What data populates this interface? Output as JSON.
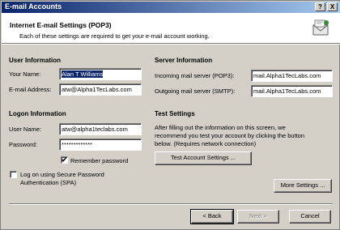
{
  "window": {
    "title": "E-mail Accounts",
    "help_glyph": "?",
    "close_glyph": "X"
  },
  "header": {
    "title": "Internet E-mail Settings (POP3)",
    "subtitle": "Each of these settings are required to get your e-mail account working."
  },
  "user_info": {
    "heading": "User Information",
    "name_label": "Your Name:",
    "name_value": "Alan T Williams",
    "email_label": "E-mail Address:",
    "email_value": "atw@Alpha1TecLabs.com"
  },
  "logon_info": {
    "heading": "Logon Information",
    "username_label": "User Name:",
    "username_value": "atw@alpha1teclabs.com",
    "password_label": "Password:",
    "password_value": "*************",
    "remember_label": "Remember password",
    "remember_checked": true,
    "spa_label_1": "Log on using Secure Password",
    "spa_label_2": "Authentication (SPA)",
    "spa_checked": false
  },
  "server_info": {
    "heading": "Server Information",
    "incoming_label": "Incoming mail server (POP3):",
    "incoming_value": "mail.Alpha1TecLabs.com",
    "outgoing_label": "Outgoing mail server (SMTP):",
    "outgoing_value": "mail.Alpha1TecLabs.com"
  },
  "test_settings": {
    "heading": "Test Settings",
    "desc_1": "After filling out the information on this screen, we",
    "desc_2": "recommend you test your account by clicking the button",
    "desc_3": "below. (Requires network connection)",
    "test_button": "Test Account Settings ..."
  },
  "buttons": {
    "more_settings": "More Settings ...",
    "back": "< Back",
    "next": "Next >",
    "cancel": "Cancel"
  },
  "check_glyph": "✔"
}
